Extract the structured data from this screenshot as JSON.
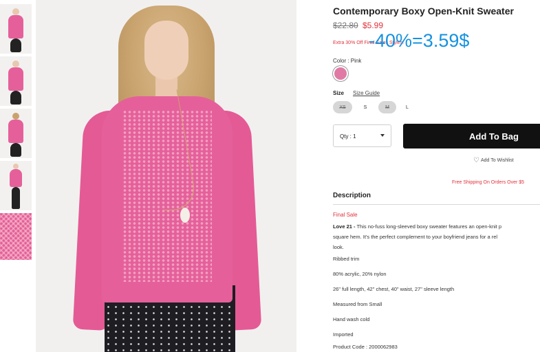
{
  "product": {
    "title": "Contemporary Boxy Open-Knit Sweater",
    "old_price": "$22.80",
    "new_price": "$5.99",
    "promo_text": "Extra 30% Off Final Sales Styles!",
    "overlay_text": "-40%=3.59$"
  },
  "color": {
    "label": "Color : Pink",
    "swatch": "#e07aa4"
  },
  "size": {
    "label": "Size",
    "guide": "Size Guide",
    "options": [
      {
        "label": "XS",
        "available": false
      },
      {
        "label": "S",
        "available": true
      },
      {
        "label": "M",
        "available": false
      },
      {
        "label": "L",
        "available": true
      }
    ]
  },
  "purchase": {
    "qty_label": "Qty : 1",
    "add_to_bag": "Add To Bag",
    "wishlist": "Add To Wishlist",
    "free_shipping": "Free Shipping On Orders Over $5"
  },
  "description": {
    "heading": "Description",
    "final_sale": "Final Sale",
    "brand": "Love 21 -",
    "line1": " This no-fuss long-sleeved boxy sweater features an open-knit p",
    "line2": "square hem. It's the perfect complement to your boyfriend jeans for a rel",
    "line3": "look.",
    "specs": [
      "Ribbed trim",
      "80% acrylic, 20% nylon",
      "26\" full length, 42\" chest, 40\" waist, 27\" sleeve length",
      "Measured from Small",
      "Hand wash cold",
      "Imported",
      "Product Code : 2000062983"
    ]
  },
  "colors": {
    "accent_pink": "#e5609a",
    "price_red": "#e0323c",
    "overlay_blue": "#1592e0",
    "button_black": "#111111"
  }
}
